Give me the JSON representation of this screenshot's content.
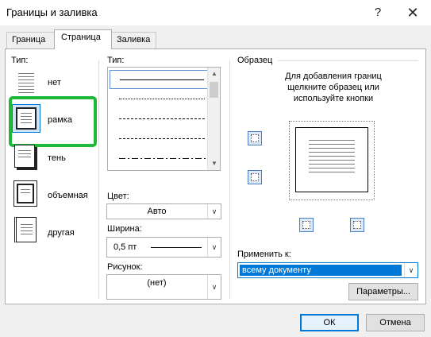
{
  "window": {
    "title": "Границы и заливка",
    "help_glyph": "?",
    "close_glyph": "✕"
  },
  "tabs": [
    {
      "label": "Граница",
      "active": false
    },
    {
      "label": "Страница",
      "active": true
    },
    {
      "label": "Заливка",
      "active": false
    }
  ],
  "type_section": {
    "label": "Тип:",
    "items": [
      {
        "label": "нет",
        "icon": "no-border-icon"
      },
      {
        "label": "рамка",
        "icon": "box-border-icon",
        "selected": true
      },
      {
        "label": "тень",
        "icon": "shadow-border-icon"
      },
      {
        "label": "объемная",
        "icon": "3d-border-icon"
      },
      {
        "label": "другая",
        "icon": "custom-border-icon"
      }
    ]
  },
  "style_section": {
    "label": "Тип:",
    "styles": [
      "solid",
      "dotted",
      "dashed-small",
      "dashed",
      "dash-dot"
    ],
    "selected_style": "solid"
  },
  "color": {
    "label": "Цвет:",
    "value": "Авто"
  },
  "width": {
    "label": "Ширина:",
    "value": "0,5 пт"
  },
  "art": {
    "label": "Рисунок:",
    "value": "(нет)"
  },
  "preview": {
    "label": "Образец",
    "hint": "Для добавления границ щелкните образец или используйте кнопки"
  },
  "apply_to": {
    "label": "Применить к:",
    "value": "всему документу"
  },
  "buttons": {
    "options": "Параметры...",
    "ok": "ОК",
    "cancel": "Отмена"
  },
  "colors": {
    "highlight_frame": "#1fb93a",
    "selection_blue": "#0078d7"
  }
}
